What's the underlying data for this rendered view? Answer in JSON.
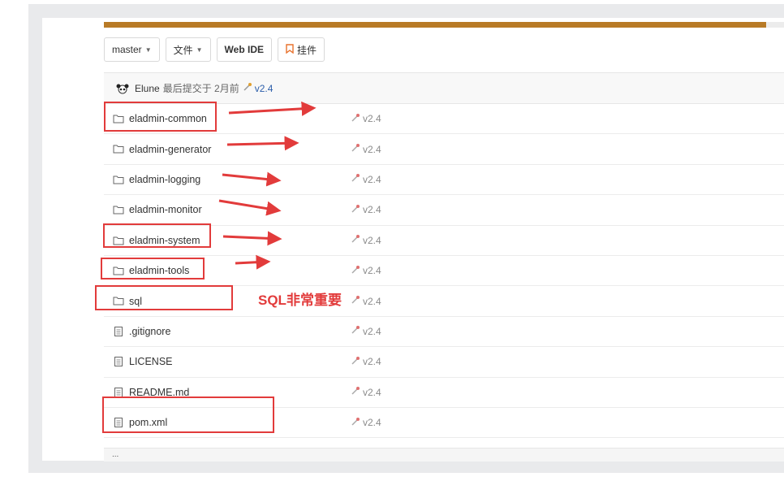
{
  "progress": {
    "value": 0.974,
    "color": "#b87a26"
  },
  "toolbar": {
    "branch_label": "master",
    "files_label": "文件",
    "webide_label": "Web IDE",
    "star_label": "挂件"
  },
  "commit": {
    "author": "Elune",
    "text": "最后提交于 2月前",
    "version": "v2.4"
  },
  "files": [
    {
      "name": "eladmin-common",
      "type": "folder",
      "commit": "v2.4"
    },
    {
      "name": "eladmin-generator",
      "type": "folder",
      "commit": "v2.4"
    },
    {
      "name": "eladmin-logging",
      "type": "folder",
      "commit": "v2.4"
    },
    {
      "name": "eladmin-monitor",
      "type": "folder",
      "commit": "v2.4"
    },
    {
      "name": "eladmin-system",
      "type": "folder",
      "commit": "v2.4"
    },
    {
      "name": "eladmin-tools",
      "type": "folder",
      "commit": "v2.4"
    },
    {
      "name": "sql",
      "type": "folder",
      "commit": "v2.4"
    },
    {
      "name": ".gitignore",
      "type": "file",
      "commit": "v2.4"
    },
    {
      "name": "LICENSE",
      "type": "file",
      "commit": "v2.4"
    },
    {
      "name": "README.md",
      "type": "file",
      "commit": "v2.4"
    },
    {
      "name": "pom.xml",
      "type": "file",
      "commit": "v2.4"
    }
  ],
  "annotation": {
    "text": "SQL非常重要",
    "color": "#e23b3b"
  },
  "footer": {
    "text": "..."
  }
}
